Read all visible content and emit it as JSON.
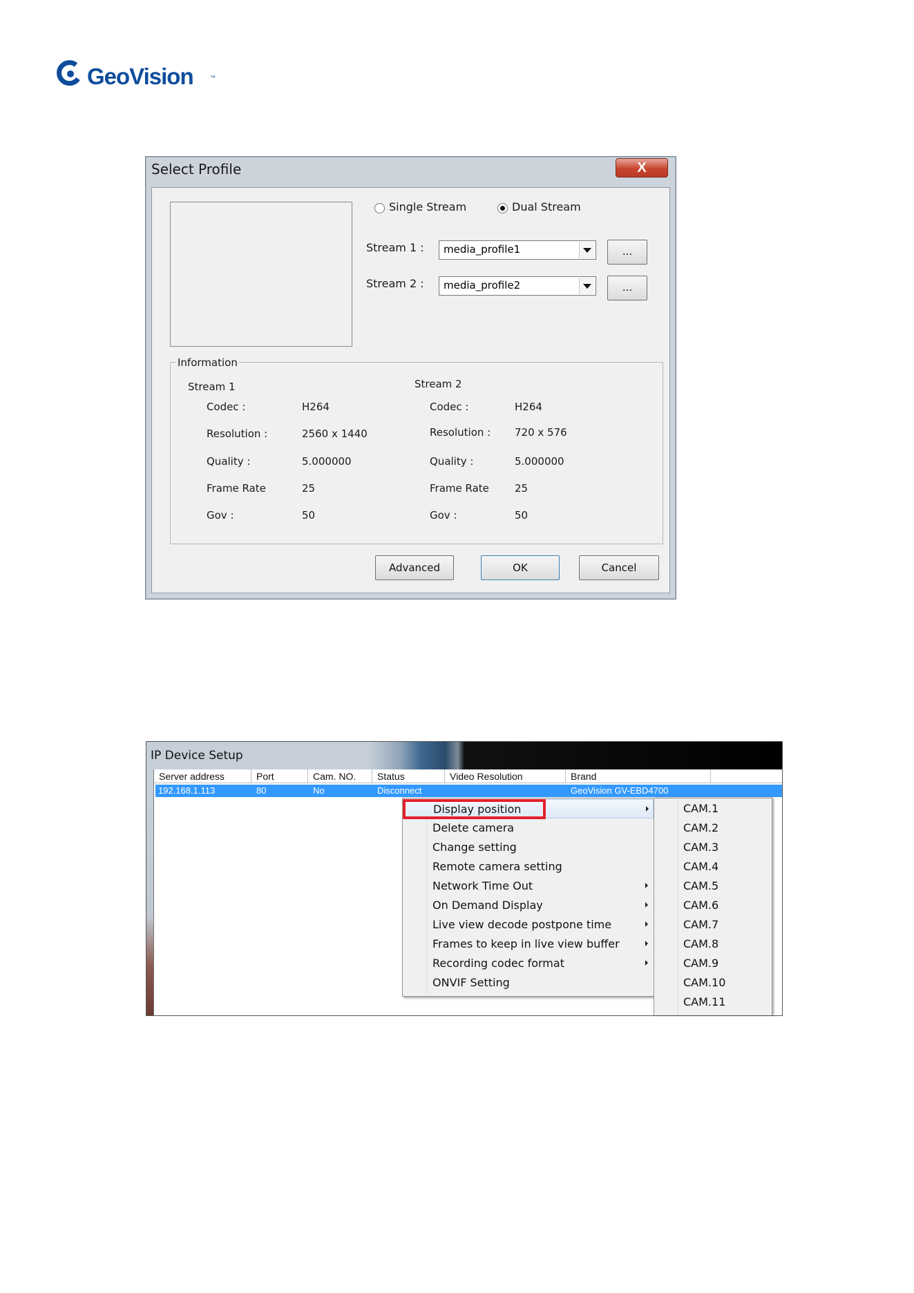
{
  "logo": {
    "brand": "GeoVision",
    "mark_color": "#0f4d9c"
  },
  "select_profile": {
    "title": "Select Profile",
    "close_glyph": "X",
    "single_stream_label": "Single Stream",
    "dual_streams_label": "Dual Streams",
    "dual_selected": true,
    "stream1_label": "Stream 1 :",
    "stream1_value": "media_profile1",
    "stream2_label": "Stream 2 :",
    "stream2_value": "media_profile2",
    "browse_label": "...",
    "info_title": "Information",
    "stream1_heading": "Stream 1",
    "stream2_heading": "Stream 2",
    "info_rows": [
      {
        "label": "Codec :",
        "s1": "H264",
        "s2": "H264"
      },
      {
        "label": "Resolution :",
        "s1": "2560 x 1440",
        "s2": "720 x 576"
      },
      {
        "label": "Quality :",
        "s1": "5.000000",
        "s2": "5.000000"
      },
      {
        "label": "Frame Rate",
        "s1": "25",
        "s2": "25"
      },
      {
        "label": "Gov :",
        "s1": "50",
        "s2": "50"
      }
    ],
    "advanced_label": "Advanced",
    "ok_label": "OK",
    "cancel_label": "Cancel"
  },
  "ip_device_setup": {
    "title": "IP Device Setup",
    "columns": [
      "Server address",
      "Port",
      "Cam. NO.",
      "Status",
      "Video Resolution",
      "Brand"
    ],
    "row": {
      "server": "192.168.1.113",
      "port": "80",
      "cam_no": "No",
      "status": "Disconnect",
      "brand": "GeoVision GV-EBD4700"
    },
    "context_menu": [
      {
        "label": "Display position",
        "submenu": true
      },
      {
        "label": "Delete camera",
        "submenu": false
      },
      {
        "label": "Change setting",
        "submenu": false
      },
      {
        "label": "Remote camera setting",
        "submenu": false
      },
      {
        "label": "Network Time Out",
        "submenu": true
      },
      {
        "label": "On Demand Display",
        "submenu": true
      },
      {
        "label": "Live view decode postpone time",
        "submenu": true
      },
      {
        "label": "Frames to keep in live view buffer",
        "submenu": true
      },
      {
        "label": "Recording codec format",
        "submenu": true
      },
      {
        "label": "ONVIF Setting",
        "submenu": false
      }
    ],
    "submenu": [
      "CAM.1",
      "CAM.2",
      "CAM.3",
      "CAM.4",
      "CAM.5",
      "CAM.6",
      "CAM.7",
      "CAM.8",
      "CAM.9",
      "CAM.10",
      "CAM.11"
    ],
    "highlight_color": "#e3202a"
  }
}
